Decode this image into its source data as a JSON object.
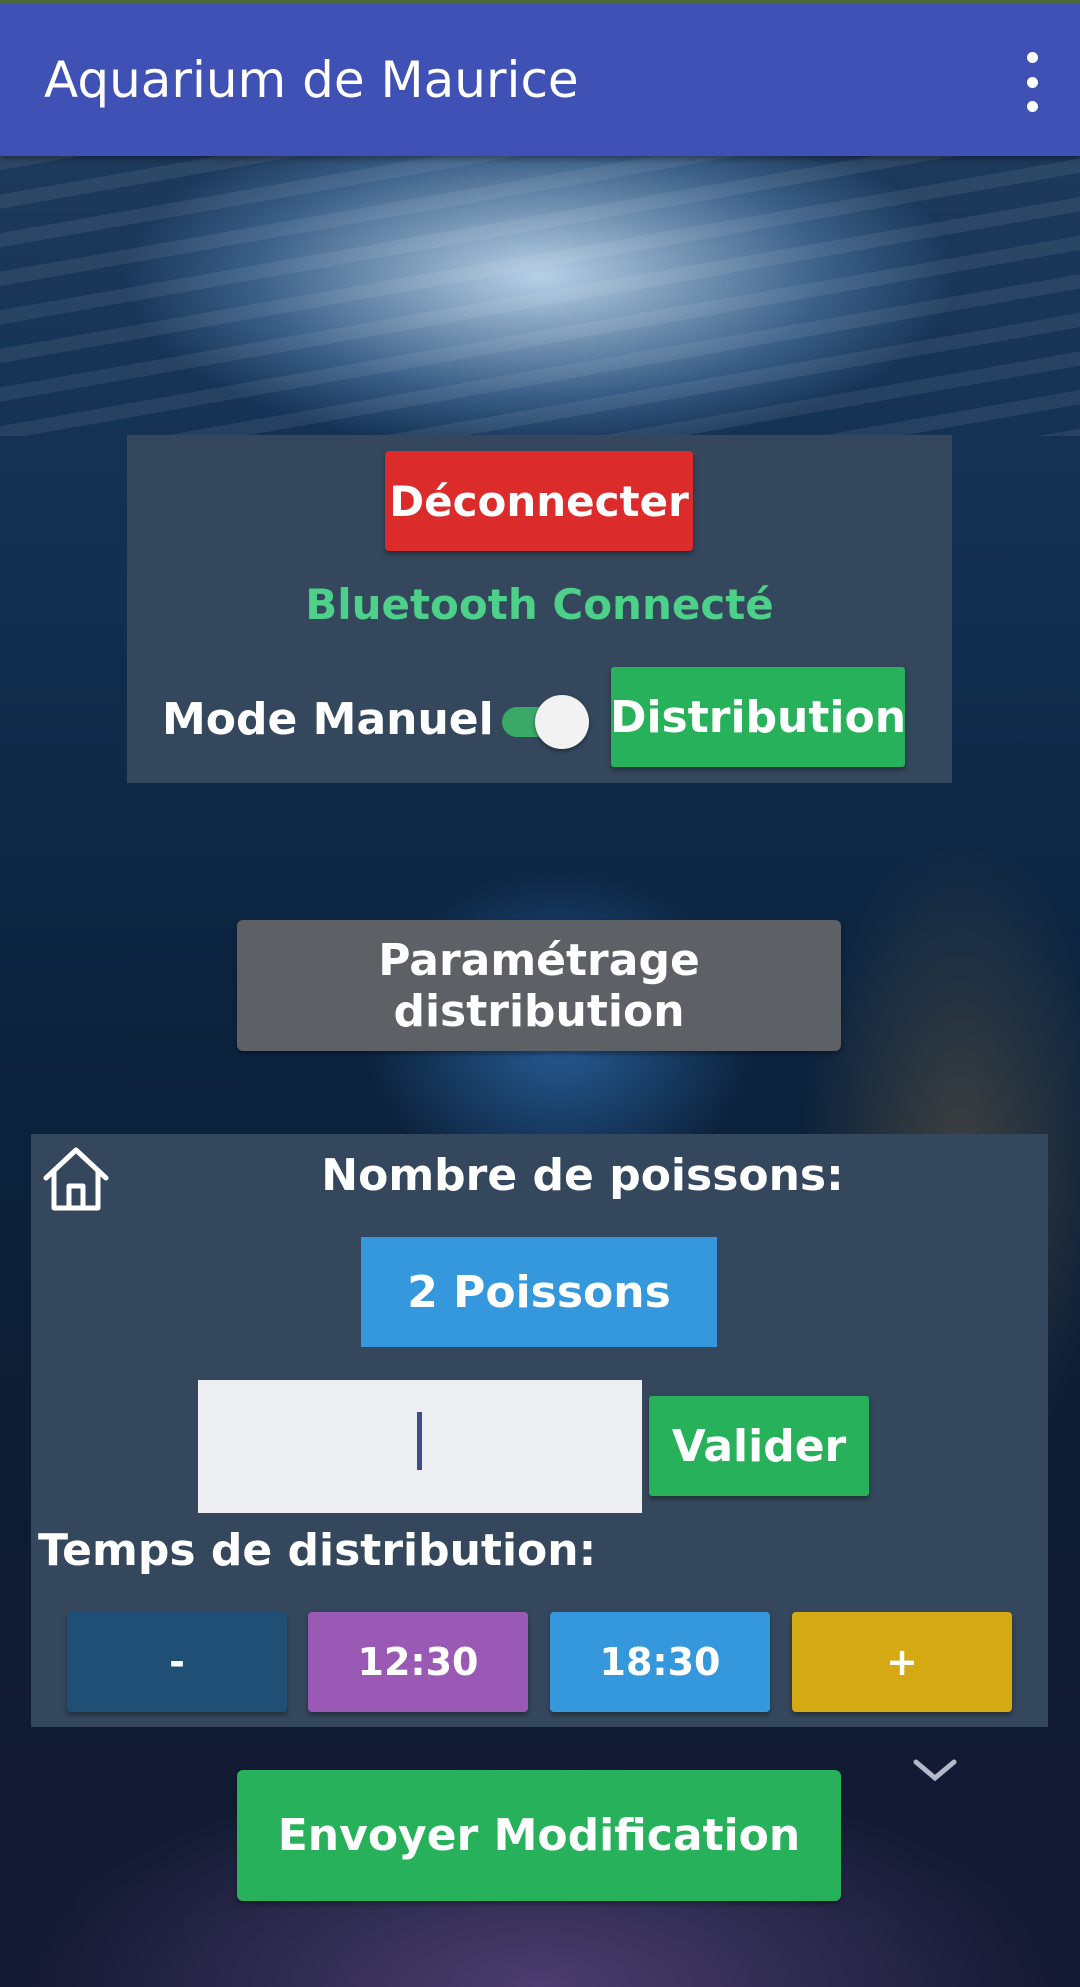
{
  "app_bar": {
    "title": "Aquarium de Maurice",
    "menu_icon": "overflow-menu-icon",
    "color": "#3f51b5"
  },
  "connection_panel": {
    "disconnect_label": "Déconnecter",
    "status_text": "Bluetooth Connecté",
    "mode_label": "Mode Manuel",
    "mode_switch_on": true,
    "distribution_label": "Distribution"
  },
  "settings_button_label": "Paramétrage distribution",
  "settings_panel": {
    "home_icon": "home-icon",
    "fish_count_label": "Nombre de poissons:",
    "fish_count_value": "2 Poissons",
    "fish_input_value": "",
    "validate_label": "Valider",
    "time_label": "Temps de distribution:",
    "time_buttons": {
      "minus": "-",
      "time1": "12:30",
      "time2": "18:30",
      "plus": "+"
    }
  },
  "send_button_label": "Envoyer Modification",
  "colors": {
    "disconnect": "#dc2b2b",
    "green": "#27b15a",
    "status_green": "#4cd08a",
    "blue": "#3598dc",
    "purple": "#9b59b6",
    "yellow": "#d4a913",
    "panel": "#34475c"
  }
}
